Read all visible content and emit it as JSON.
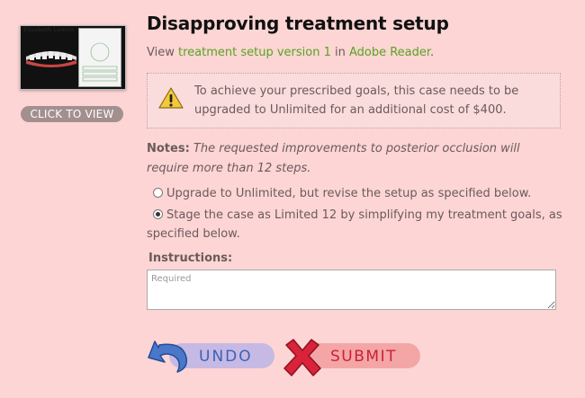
{
  "thumbnail": {
    "patient_name": "Elizabeth Lemon",
    "click_label": "CLICK TO VIEW"
  },
  "header": {
    "title": "Disapproving treatment setup"
  },
  "view_line": {
    "prefix": "View ",
    "setup_link": "treatment setup version 1",
    "middle": " in ",
    "reader_link": "Adobe Reader",
    "suffix": "."
  },
  "alert": {
    "icon": "warning-icon",
    "message": "To achieve your prescribed goals, this case needs to be upgraded to Unlimited for an additional cost of $400."
  },
  "notes": {
    "label": "Notes:",
    "text": " The requested improvements to posterior occlusion will require more than 12 steps."
  },
  "options": [
    {
      "label": "Upgrade to Unlimited, but revise the setup as specified below.",
      "selected": false
    },
    {
      "label": "Stage the case as Limited 12 by simplifying my treatment goals, as specified below.",
      "selected": true
    }
  ],
  "instructions": {
    "label": "Instructions:",
    "placeholder": "Required",
    "value": ""
  },
  "actions": {
    "undo_label": "UNDO",
    "submit_label": "SUBMIT"
  },
  "colors": {
    "background": "#fdd5d5",
    "link": "#55a51f",
    "undo": "#3b63b6",
    "submit": "#c9213a"
  }
}
